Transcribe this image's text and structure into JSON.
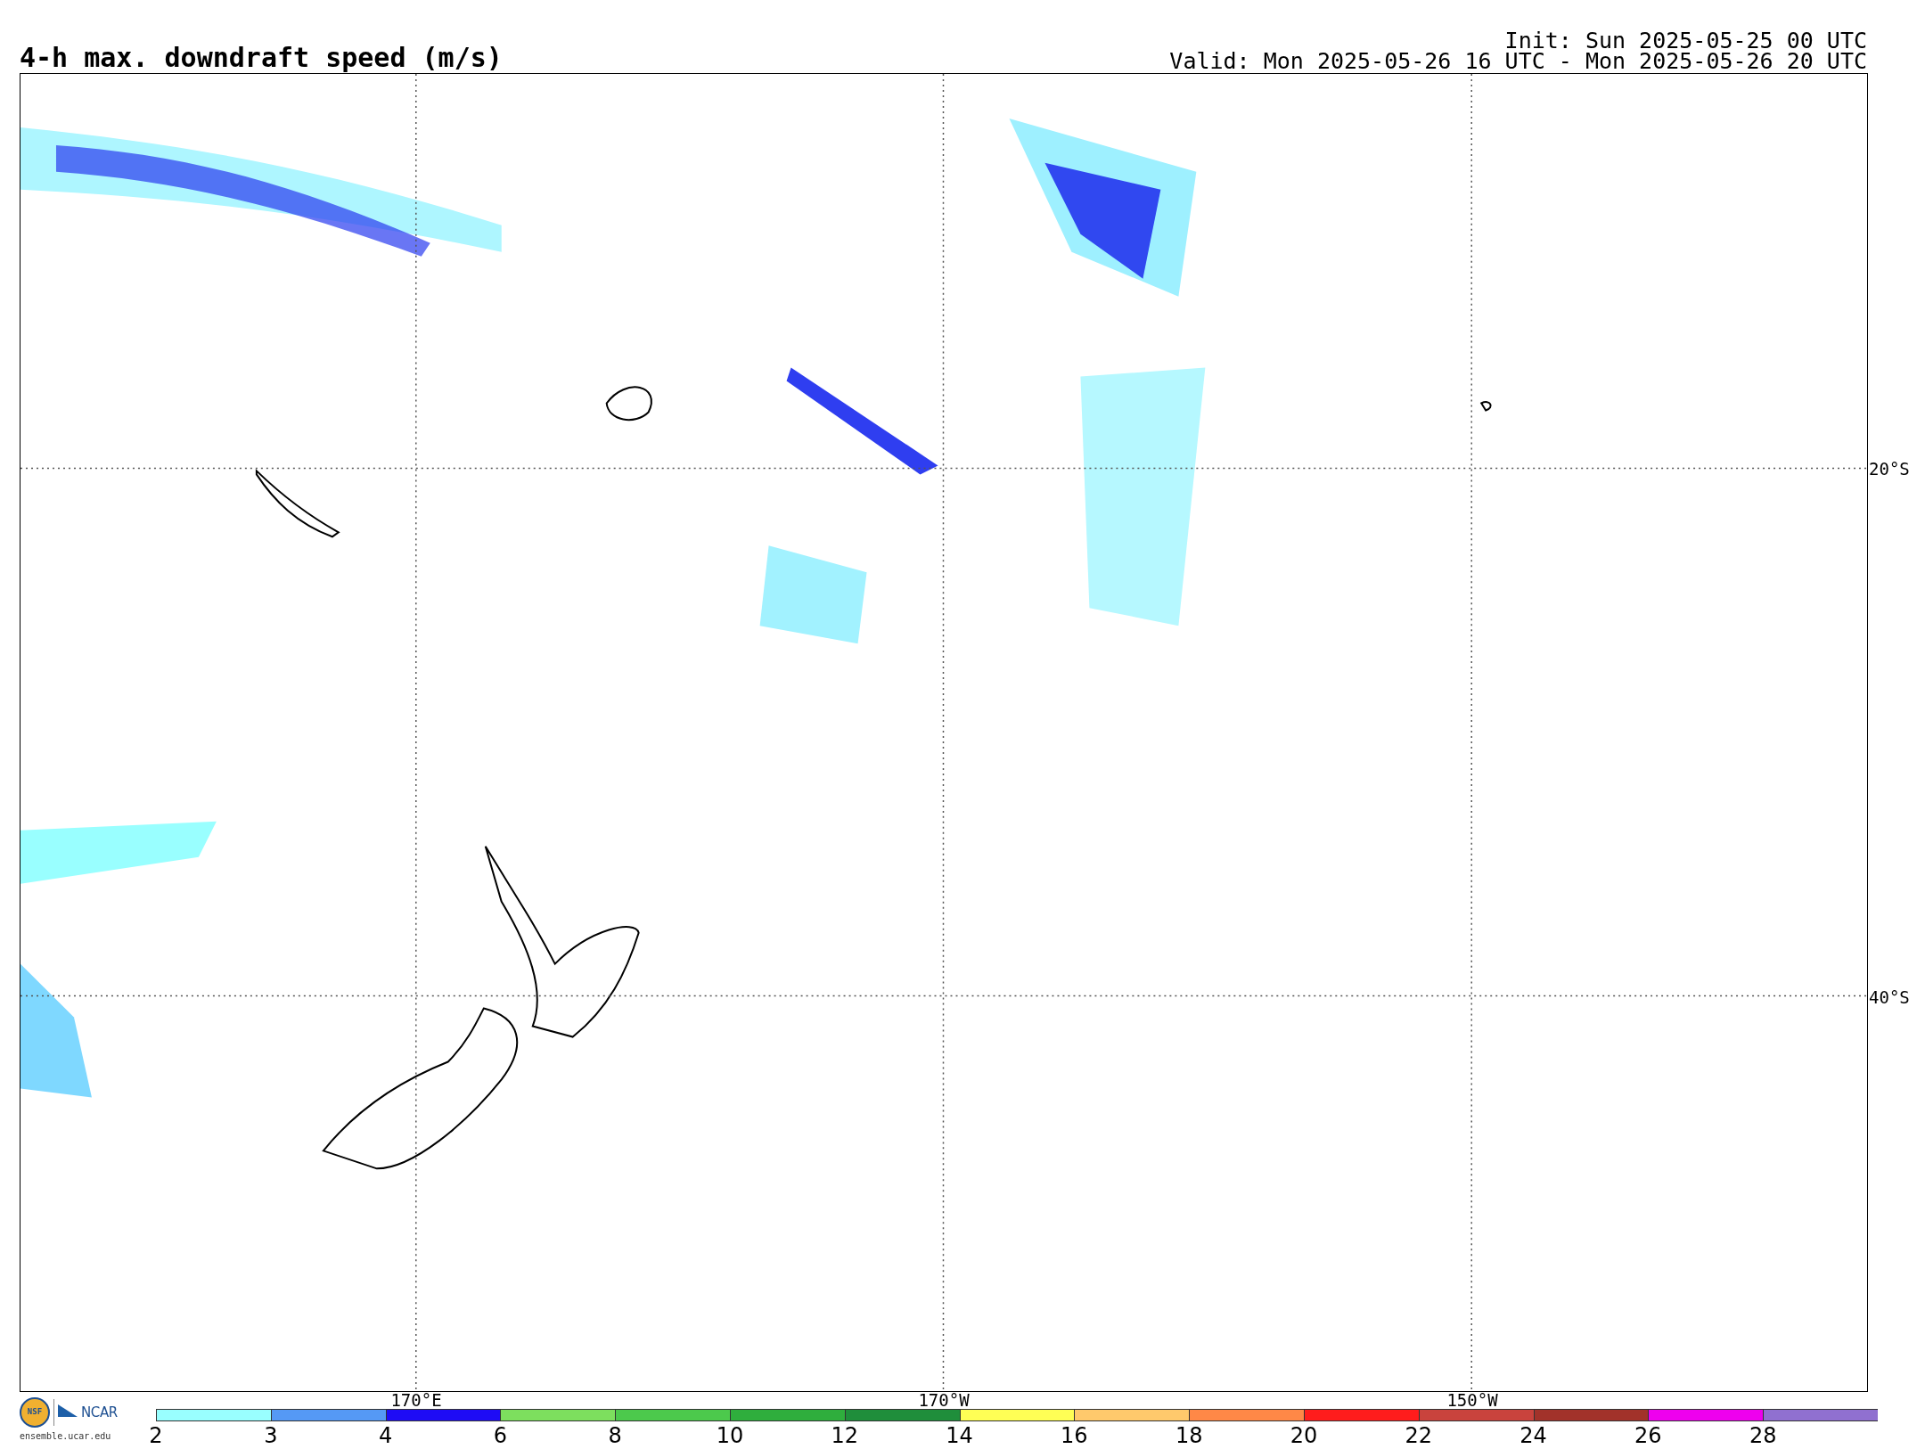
{
  "title": "4-h max. downdraft speed (m/s)",
  "init": "Init: Sun 2025-05-25 00 UTC",
  "valid": "Valid: Mon 2025-05-26 16 UTC - Mon 2025-05-26 20 UTC",
  "map": {
    "lat_labels": [
      "20°S",
      "40°S"
    ],
    "lon_labels": [
      "170°E",
      "170°W",
      "150°W"
    ]
  },
  "logo": {
    "badge": "NSF",
    "name": "NCAR",
    "url": "ensemble.ucar.edu"
  },
  "colorbar": [
    {
      "label": "2",
      "color": "#99ffff"
    },
    {
      "label": "3",
      "color": "#5599f5"
    },
    {
      "label": "4",
      "color": "#1e0cf5"
    },
    {
      "label": "6",
      "color": "#7ddf5e"
    },
    {
      "label": "8",
      "color": "#4cc94c"
    },
    {
      "label": "10",
      "color": "#2fae3d"
    },
    {
      "label": "12",
      "color": "#1f8e3b"
    },
    {
      "label": "14",
      "color": "#ffff55"
    },
    {
      "label": "16",
      "color": "#ffc96c"
    },
    {
      "label": "18",
      "color": "#ff8847"
    },
    {
      "label": "20",
      "color": "#ff1c1c"
    },
    {
      "label": "22",
      "color": "#c9433d"
    },
    {
      "label": "24",
      "color": "#a2322a"
    },
    {
      "label": "26",
      "color": "#ee00ee"
    },
    {
      "label": "28",
      "color": "#9070d0"
    }
  ]
}
